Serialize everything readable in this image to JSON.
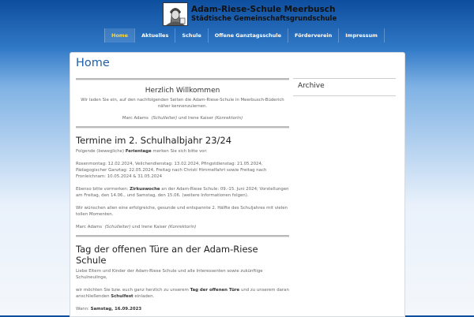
{
  "site": {
    "title": "Adam-Riese-Schule Meerbusch",
    "subtitle": "Städtische Gemeinschaftsgrundschule",
    "logo_icon": "adam-riese-portrait-logo"
  },
  "nav": {
    "items": [
      {
        "label": "Home",
        "active": true
      },
      {
        "label": "Aktuelles"
      },
      {
        "label": "Schule"
      },
      {
        "label": "Offene Ganztagsschule"
      },
      {
        "label": "Förderverein"
      },
      {
        "label": "Impressum"
      }
    ]
  },
  "page": {
    "title": "Home"
  },
  "welcome": {
    "heading": "Herzlich Willkommen",
    "text": "Wir laden Sie ein, auf den nachfolgenden Seiten die Adam-Riese-Schule in Meerbusch-Büderich näher kennenzulernen.",
    "sign_name1": "Marc Adams",
    "sign_role1": "(Schulleiter)",
    "sign_and": "und",
    "sign_name2": "Irene Kaiser",
    "sign_role2": "(Konrektorin)"
  },
  "termine": {
    "heading": "Termine im 2. Schulhalbjahr 23/24",
    "intro_pre": "Folgende (bewegliche)",
    "intro_bold": "Ferientage",
    "intro_post": "merken Sie sich bitte vor:",
    "dates": "Rosenmontag: 12.02.2024, Veilchendienstag: 13.02.2024, Pfingstdienstag: 21.05.2024, Pädagogischer Ganztag: 22.05.2024, Freitag nach Christi Himmelfahrt sowie Freitag nach Fronleichnam: 10.05.2024 & 31.05.2024",
    "zw_pre": "Ebenso bitte vormerken:",
    "zw_bold": "Zirkuswoche",
    "zw_post": "an der Adam-Riese Schule: 09.-15. Juni 2024; Vorstellungen am Freitag, den 14.06., und Samstag, den 15.06. (weitere Informationen folgen).",
    "wishes": "Wir wünschen allen eine erfolgreiche, gesunde und entspannte 2. Hälfte des Schuljahres mit vielen tollen Momenten.",
    "sign_name1": "Marc Adams",
    "sign_role1": "(Schulleiter)",
    "sign_and": "und",
    "sign_name2": "Irene Kaiser",
    "sign_role2": "(Konrektorin)"
  },
  "tag": {
    "heading": "Tag der offenen Türe an der Adam-Riese Schule",
    "p1": "Liebe Eltern und Kinder der Adam-Riese Schule und alle Interessenten sowie zukünftige Schulneulinge,",
    "p2_pre": "wir möchten Sie bzw. euch ganz herzlich zu unserem",
    "p2_bold1": "Tag der offenen Türe",
    "p2_mid": "und zu unserem daran anschließenden",
    "p2_bold2": "Schulfest",
    "p2_post": "einladen.",
    "p3_pre": "Wann:",
    "p3_bold": "Samstag, 16.09.2023"
  },
  "sidebar": {
    "title": "Archive"
  }
}
